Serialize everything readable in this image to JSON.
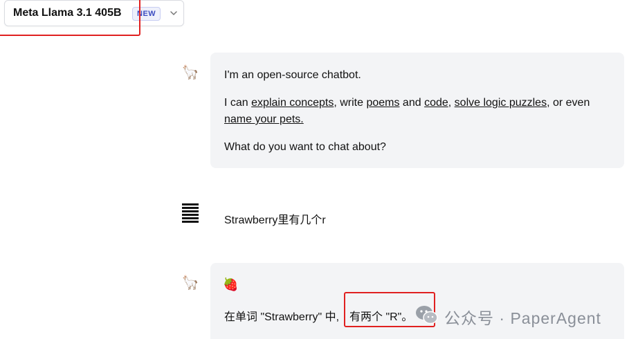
{
  "header": {
    "model_name": "Meta Llama 3.1 405B",
    "badge": "NEW",
    "dropdown_icon": "chevron-down-icon"
  },
  "messages": [
    {
      "role": "assistant",
      "avatar": "🦙",
      "intro": "I'm an open-source chatbot.",
      "line2_prefix": "I can ",
      "link_explain": "explain concepts",
      "sep1": ", write ",
      "link_poems": "poems",
      "sep2": " and ",
      "link_code": "code",
      "sep3": ", ",
      "link_logic": "solve logic puzzles",
      "sep4": ", or even",
      "link_pets": "name your pets.",
      "question": "What do you want to chat about?"
    },
    {
      "role": "user",
      "icon": "user-icon",
      "text": "Strawberry里有几个r"
    },
    {
      "role": "assistant",
      "avatar": "🦙",
      "emoji": "🍓",
      "answer_prefix": "在单词 \"Strawberry\" 中,",
      "answer_highlight": "有两个 \"R\"。"
    }
  ],
  "watermark": {
    "icon": "wechat-icon",
    "text": "公众号 · PaperAgent"
  },
  "colors": {
    "highlight": "#e02020",
    "bubble": "#f3f4f6",
    "badge_text": "#3b4cc0"
  }
}
